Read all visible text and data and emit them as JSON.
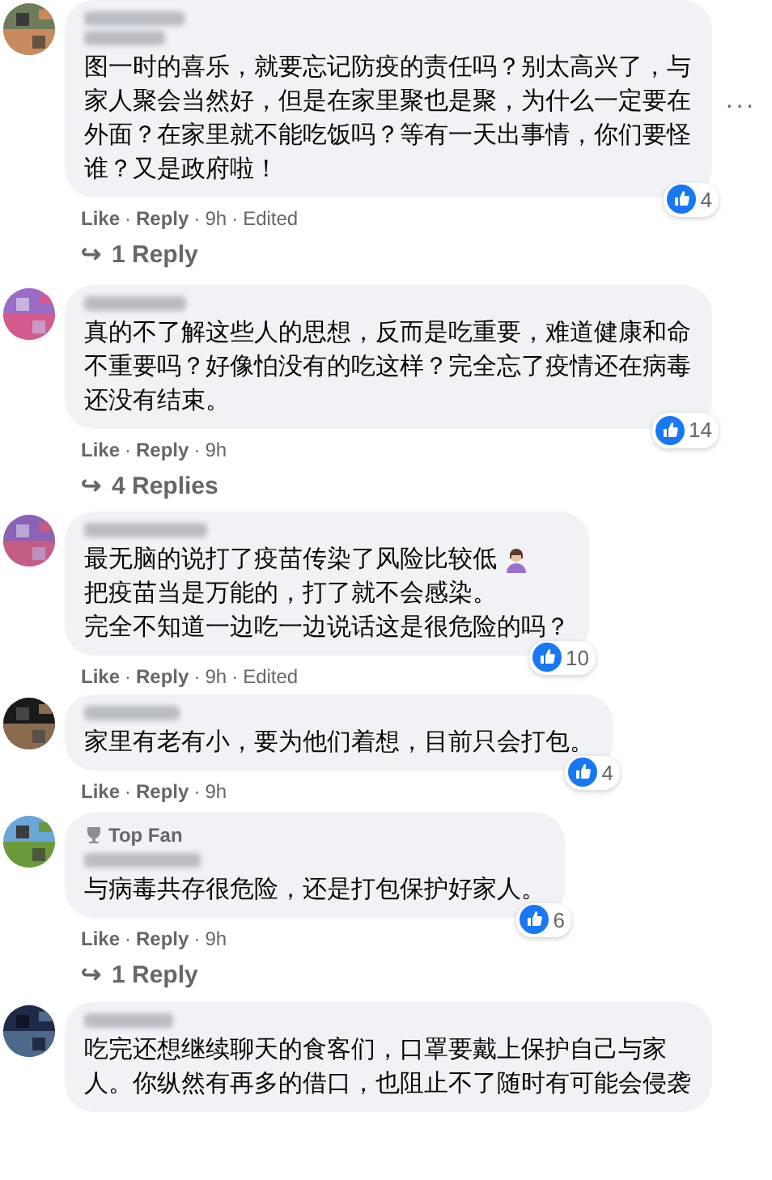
{
  "comments": [
    {
      "badge_hidden": true,
      "paragraphs": [
        {
          "text": "图一时的喜乐，就要忘记防疫的责任吗？别太高兴了，与家人聚会当然好，但是在家里聚也是聚，为什么一定要在外面？在家里就不能吃饭吗？等有一天出事情，你们要怪谁？又是政府啦！",
          "emoji": false
        }
      ],
      "meta": [
        "Like",
        "·",
        "Reply",
        "·",
        "9h",
        "·",
        "Edited"
      ],
      "reactions": "4",
      "more_menu": "···",
      "replies": {
        "arrow": "↪",
        "label": "1 Reply"
      }
    },
    {
      "badge_hidden": false,
      "paragraphs": [
        {
          "text": "真的不了解这些人的思想，反而是吃重要，难道健康和命不重要吗？好像怕没有的吃这样？完全忘了疫情还在病毒还没有结束。",
          "emoji": false
        }
      ],
      "meta": [
        "Like",
        "·",
        "Reply",
        "·",
        "9h"
      ],
      "reactions": "14",
      "replies": {
        "arrow": "↪",
        "label": "4 Replies"
      }
    },
    {
      "badge_hidden": false,
      "paragraphs": [
        {
          "text": "最无脑的说打了疫苗传染了风险比较低",
          "emoji": true
        },
        {
          "text": "把疫苗当是万能的，打了就不会感染。",
          "emoji": false
        },
        {
          "text": "完全不知道一边吃一边说话这是很危险的吗？",
          "emoji": false
        }
      ],
      "meta": [
        "Like",
        "·",
        "Reply",
        "·",
        "9h",
        "·",
        "Edited"
      ],
      "reactions": "10"
    },
    {
      "badge_hidden": false,
      "paragraphs": [
        {
          "text": "家里有老有小，要为他们着想，目前只会打包。",
          "emoji": false
        }
      ],
      "meta": [
        "Like",
        "·",
        "Reply",
        "·",
        "9h"
      ],
      "reactions": "4"
    },
    {
      "badge_hidden": false,
      "badge": "Top Fan",
      "paragraphs": [
        {
          "text": "与病毒共存很危险，还是打包保护好家人。",
          "emoji": false
        }
      ],
      "meta": [
        "Like",
        "·",
        "Reply",
        "·",
        "9h"
      ],
      "reactions": "6",
      "replies": {
        "arrow": "↪",
        "label": "1 Reply"
      }
    },
    {
      "badge_hidden": false,
      "paragraphs": [
        {
          "text": "吃完还想继续聊天的食客们，口罩要戴上保护自己与家人。你纵然有再多的借口，也阻止不了随时有可能会侵袭",
          "emoji": false
        }
      ]
    }
  ]
}
